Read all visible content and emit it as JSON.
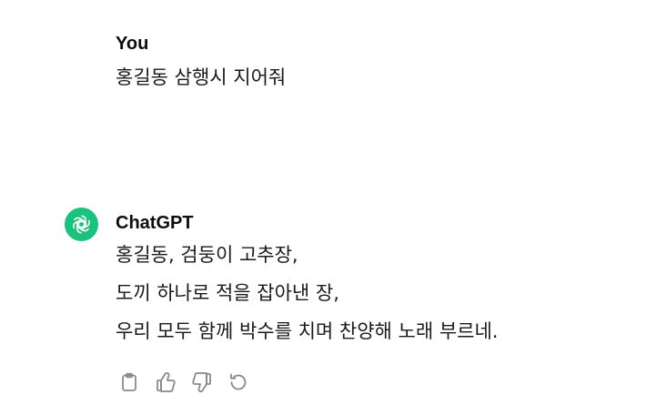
{
  "conversation": {
    "user": {
      "author": "You",
      "text": "홍길동 삼행시 지어줘"
    },
    "assistant": {
      "author": "ChatGPT",
      "avatar_icon": "openai-logo-icon",
      "avatar_color": "#19c37d",
      "lines": [
        "홍길동, 검둥이 고추장,",
        "도끼 하나로 적을 잡아낸 장,",
        "우리 모두 함께 박수를 치며 찬양해 노래 부르네."
      ]
    },
    "actions": [
      {
        "icon": "clipboard-icon"
      },
      {
        "icon": "thumbs-up-icon"
      },
      {
        "icon": "thumbs-down-icon"
      },
      {
        "icon": "regenerate-icon"
      }
    ]
  }
}
